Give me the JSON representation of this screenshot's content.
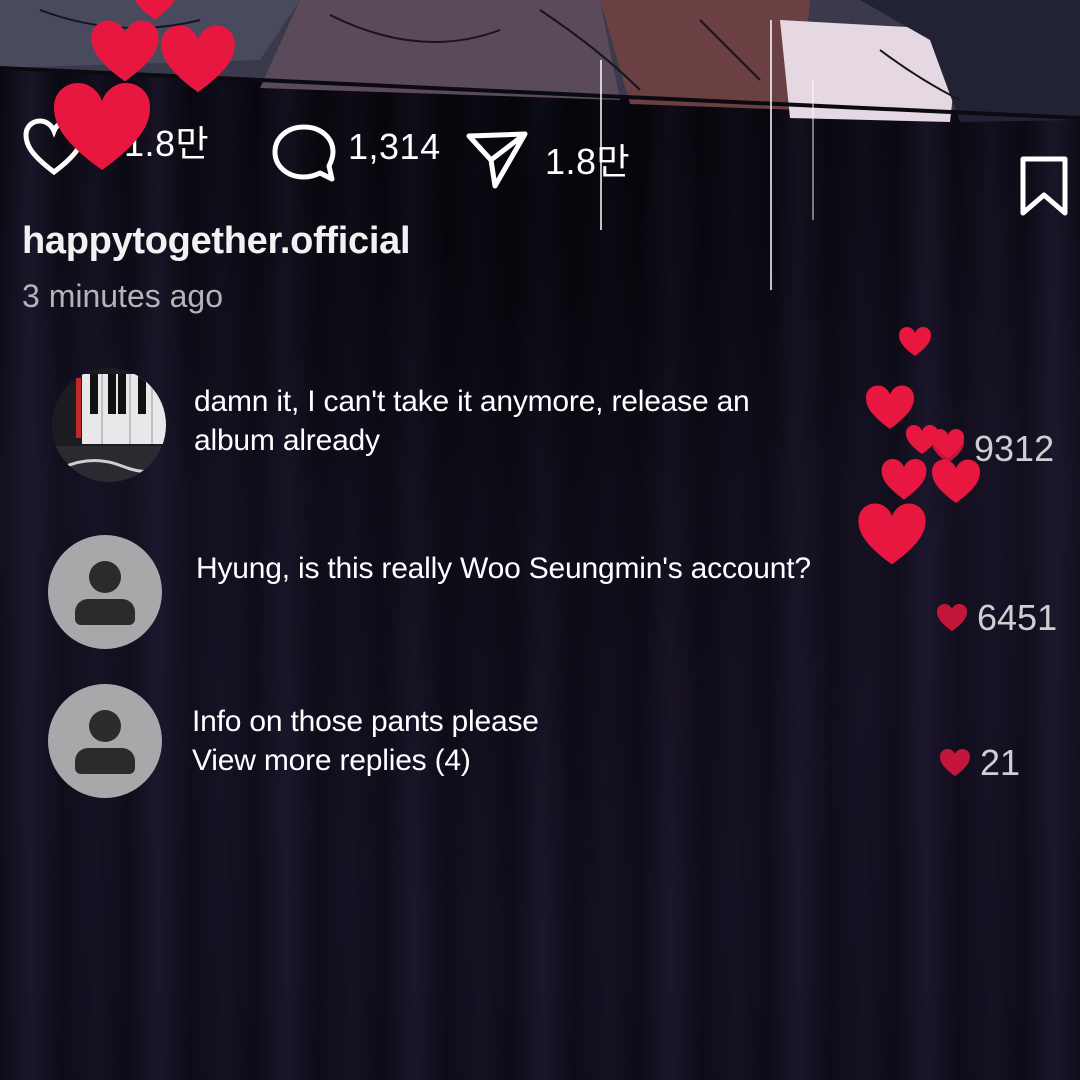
{
  "post": {
    "likes": "1.8만",
    "comments_count": "1,314",
    "shares": "1.8만",
    "username": "happytogether.official",
    "time_ago": "3 minutes ago"
  },
  "icons": {
    "like": "heart-outline-icon",
    "comment": "speech-bubble-icon",
    "share": "paper-plane-icon",
    "save": "bookmark-icon",
    "comment_like": "heart-filled-icon"
  },
  "comments": [
    {
      "avatar": "piano-photo",
      "text_line1": "damn it, I can't take it anymore, release an",
      "text_line2": "album already",
      "likes": "9312"
    },
    {
      "avatar": "default-user",
      "text_line1": "Hyung, is this really Woo Seungmin's account?",
      "likes": "6451"
    },
    {
      "avatar": "default-user",
      "text_line1": "Info on those pants please",
      "view_replies": "View more replies (4)",
      "likes": "21"
    }
  ],
  "colors": {
    "heart_red": "#e8173f",
    "comment_heart": "#c4163a",
    "muted_text": "#b4b4b8"
  }
}
